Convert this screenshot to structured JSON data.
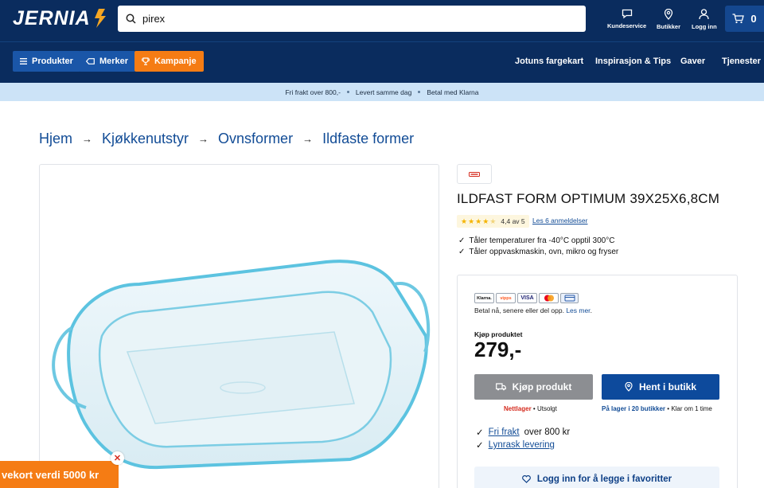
{
  "header": {
    "logo": "JERNIA",
    "search_value": "pirex",
    "tools": {
      "customer_service": "Kundeservice",
      "stores": "Butikker",
      "login": "Logg inn"
    },
    "cart_count": "0"
  },
  "nav": {
    "products": "Produkter",
    "brands": "Merker",
    "campaign": "Kampanje",
    "links": [
      "Jotuns fargekart",
      "Inspirasjon & Tips",
      "Gaver",
      "Tjenester"
    ]
  },
  "usp": [
    "Fri frakt over 800,-",
    "Levert samme dag",
    "Betal med Klarna"
  ],
  "breadcrumb": [
    "Hjem",
    "Kjøkkenutstyr",
    "Ovnsformer",
    "Ildfaste former"
  ],
  "product": {
    "title": "ILDFAST FORM OPTIMUM 39X25X6,8CM",
    "rating_value": 4.4,
    "rating_text": "4,4 av 5",
    "reviews_link": "Les 6 anmeldelser",
    "features": [
      "Tåler temperaturer fra -40°C opptil 300°C",
      "Tåler oppvaskmaskin, ovn, mikro og fryser"
    ]
  },
  "payment": {
    "methods": [
      "Klarna.",
      "vipps",
      "VISA"
    ],
    "text": "Betal nå, senere eller del opp.",
    "link": "Les mer"
  },
  "buy": {
    "label": "Kjøp produktet",
    "price": "279,-",
    "buy_button": "Kjøp produkt",
    "pickup_button": "Hent i butikk",
    "online_status": "Nettlager",
    "online_status_value": "Utsolgt",
    "store_status": "På lager i 20 butikker",
    "store_ready": "Klar om 1 time",
    "perks": [
      {
        "link": "Fri frakt",
        "rest": " over 800 kr"
      },
      {
        "link": "Lynrask levering",
        "rest": ""
      }
    ],
    "favorite_button": "Logg inn for å legge i favoritter"
  },
  "promo": {
    "text": "vekort verdi 5000 kr"
  },
  "colors": {
    "header_bg": "#0a2c5e",
    "nav_blue": "#1a56a8",
    "accent_orange": "#f57c14",
    "usp_bg": "#cce3f7",
    "link_blue": "#124c96",
    "button_blue": "#0d4a9c",
    "button_grey": "#8c8e92"
  }
}
